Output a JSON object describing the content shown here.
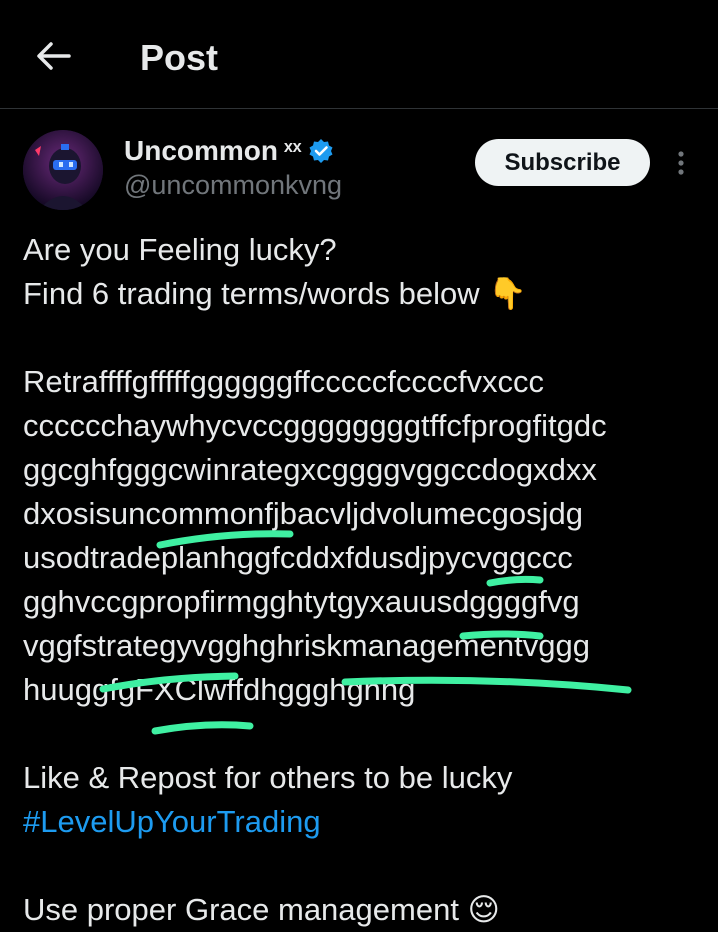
{
  "header": {
    "title": "Post"
  },
  "author": {
    "display_name": "Uncommon",
    "name_glyph": "ˣˣ",
    "handle": "@uncommonkvng",
    "verified_color": "#1d9bf0"
  },
  "actions": {
    "subscribe_label": "Subscribe"
  },
  "post": {
    "intro_line1": "Are you Feeling lucky?",
    "intro_line2": "Find 6 trading terms/words below",
    "intro_emoji": "👇",
    "puzzle_lines": [
      "Retraffffgfffffggggggffcccccfccccfvxccc",
      "cccccchaywhycvccggggggggtffcfprogfitgdc",
      "ggcghfgggcwinrategxcggggvggccdogxdxx",
      "dxosisuncommonfjbacvljdvolumecgosjdg",
      "usodtradeplanhggfcddxfdusdjpycvggccc",
      "gghvccgpropfirmgghtytgyxauusdggggfvg",
      "vggfstrategyvgghghriskmanagementvggg",
      "huuggfgFXClwffdhggghghhg"
    ],
    "cta": "Like & Repost for others to be lucky",
    "hashtag": "#LevelUpYourTrading",
    "footer_partial": "Use proper Grace management",
    "footer_emoji": "😌",
    "highlight_color": "#3ff0a2"
  }
}
